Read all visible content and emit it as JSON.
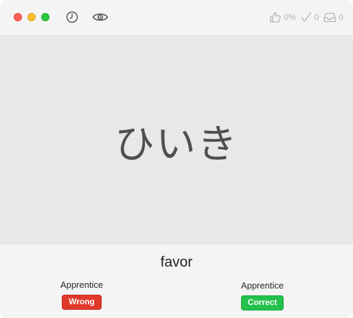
{
  "toolbar": {
    "history_icon": "clock-icon",
    "show_icon": "eye-icon",
    "stats": {
      "success_rate": "0%",
      "done_count": "0",
      "queue_count": "0"
    }
  },
  "card": {
    "reading": "ひいき"
  },
  "answer": {
    "meaning": "favor",
    "left": {
      "level": "Apprentice",
      "status": "Wrong"
    },
    "right": {
      "level": "Apprentice",
      "status": "Correct"
    }
  },
  "colors": {
    "wrong": "#e0392b",
    "correct": "#24c14d",
    "card_background": "#e8e8e8"
  }
}
